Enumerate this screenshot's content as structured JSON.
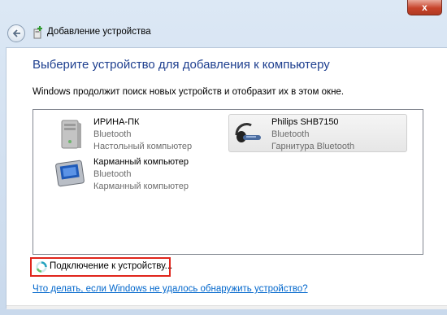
{
  "window": {
    "title": "Добавление устройства",
    "close_label": "x"
  },
  "main": {
    "heading": "Выберите устройство для добавления к компьютеру",
    "subtext": "Windows продолжит поиск новых устройств и отобразит их в этом окне."
  },
  "devices": [
    {
      "name": "ИРИНА-ПК",
      "type": "Bluetooth",
      "category": "Настольный компьютер",
      "icon": "desktop-computer-icon",
      "selected": false
    },
    {
      "name": "Philips SHB7150",
      "type": "Bluetooth",
      "category": "Гарнитура Bluetooth",
      "icon": "headset-icon",
      "selected": true
    },
    {
      "name": "Карманный компьютер",
      "type": "Bluetooth",
      "category": "Карманный компьютер",
      "icon": "pda-icon",
      "selected": false
    }
  ],
  "status": {
    "text": "Подключение к устройству..."
  },
  "help_link": "Что делать, если Windows не удалось обнаружить устройство?",
  "colors": {
    "heading": "#1e3f8f",
    "link": "#0066cc",
    "highlight_border": "#e0251b"
  }
}
